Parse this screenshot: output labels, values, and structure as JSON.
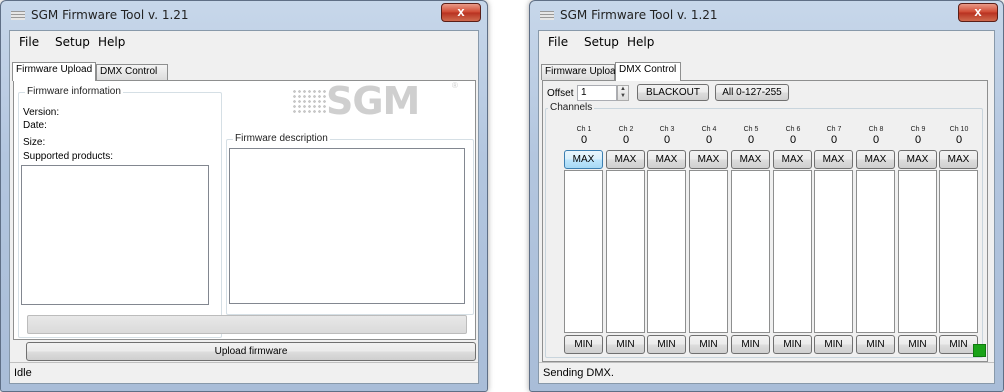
{
  "window1": {
    "title": "SGM Firmware Tool v. 1.21",
    "close_glyph": "x",
    "menu": [
      "File",
      "Setup",
      "Help"
    ],
    "tabs": [
      "Firmware Upload",
      "DMX Control"
    ],
    "active_tab": "Firmware Upload",
    "firmware_info": {
      "label": "Firmware information",
      "version_label": "Version:",
      "date_label": "Date:",
      "size_label": "Size:",
      "supported_label": "Supported products:"
    },
    "logo_text": "SGM",
    "logo_reg": "®",
    "firmware_description_label": "Firmware description",
    "upload_progress": 0,
    "upload_button": "Upload firmware",
    "status": "Idle"
  },
  "window2": {
    "title": "SGM Firmware Tool v. 1.21",
    "close_glyph": "x",
    "menu": [
      "File",
      "Setup",
      "Help"
    ],
    "tabs": [
      "Firmware Upload",
      "DMX Control"
    ],
    "active_tab": "DMX Control",
    "offset_label": "Offset",
    "offset_value": "1",
    "blackout_button": "BLACKOUT",
    "all_button": "All 0-127-255",
    "channels_label": "Channels",
    "channels": [
      {
        "name": "Ch 1",
        "value": "0"
      },
      {
        "name": "Ch 2",
        "value": "0"
      },
      {
        "name": "Ch 3",
        "value": "0"
      },
      {
        "name": "Ch 4",
        "value": "0"
      },
      {
        "name": "Ch 5",
        "value": "0"
      },
      {
        "name": "Ch 6",
        "value": "0"
      },
      {
        "name": "Ch 7",
        "value": "0"
      },
      {
        "name": "Ch 8",
        "value": "0"
      },
      {
        "name": "Ch 9",
        "value": "0"
      },
      {
        "name": "Ch 10",
        "value": "0"
      }
    ],
    "max_label": "MAX",
    "min_label": "MIN",
    "indicator_color": "#1aa318",
    "status": "Sending DMX."
  }
}
